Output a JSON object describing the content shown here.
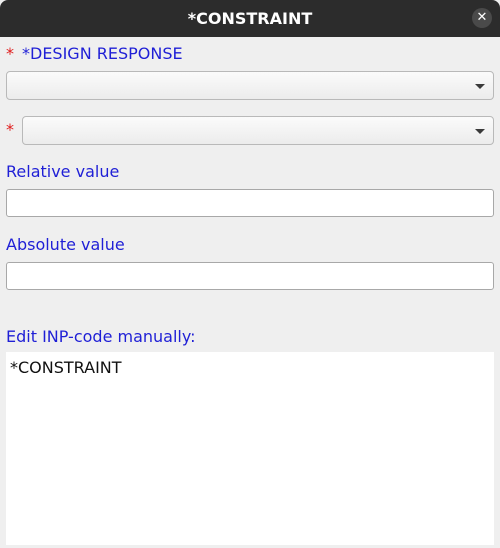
{
  "window": {
    "title": "*CONSTRAINT",
    "close_glyph": "✕"
  },
  "form": {
    "required_marker": "*",
    "design_response_label": "*DESIGN RESPONSE",
    "design_response_value": "",
    "second_select_value": "",
    "relative_value_label": "Relative value",
    "relative_value": "",
    "absolute_value_label": "Absolute value",
    "absolute_value": "",
    "inp_code_label": "Edit INP-code manually:",
    "inp_code": "*CONSTRAINT"
  },
  "colors": {
    "label_blue": "#1f1fd6",
    "required_red": "#e01b1b",
    "titlebar": "#2c2c2c"
  },
  "icons": {
    "close": "close-icon",
    "dropdown": "chevron-down-icon"
  }
}
